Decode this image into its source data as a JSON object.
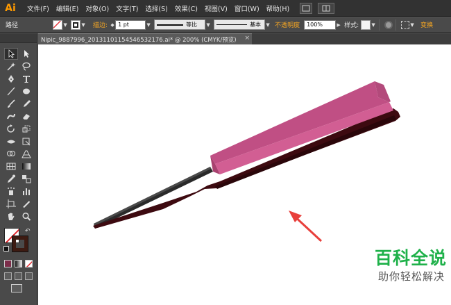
{
  "app": {
    "logo": "Ai"
  },
  "menubar": {
    "items": [
      "文件(F)",
      "编辑(E)",
      "对象(O)",
      "文字(T)",
      "选择(S)",
      "效果(C)",
      "视图(V)",
      "窗口(W)",
      "帮助(H)"
    ]
  },
  "controlbar": {
    "selection_label": "路径",
    "stroke_label": "描边:",
    "stroke_weight": "1 pt",
    "profile_label": "等比",
    "brush_label": "基本",
    "opacity_label": "不透明度",
    "opacity_value": "100%",
    "style_label": "样式:",
    "transform_label": "变换"
  },
  "document": {
    "tab_title": "Nipic_9887996_20131101154546532176.ai* @ 200% (CMYK/预览)",
    "close_symbol": "×"
  },
  "artwork": {
    "description_colors": {
      "fan_pink": "#c04f84",
      "fan_pink_light": "#d25e93",
      "fan_dark": "#3d0a10",
      "handle": "#1e1e1e",
      "arrow": "#e8403c"
    }
  },
  "watermark": {
    "title": "百科全说",
    "subtitle": "助你轻松解决",
    "title_color": "#1fb14a"
  }
}
